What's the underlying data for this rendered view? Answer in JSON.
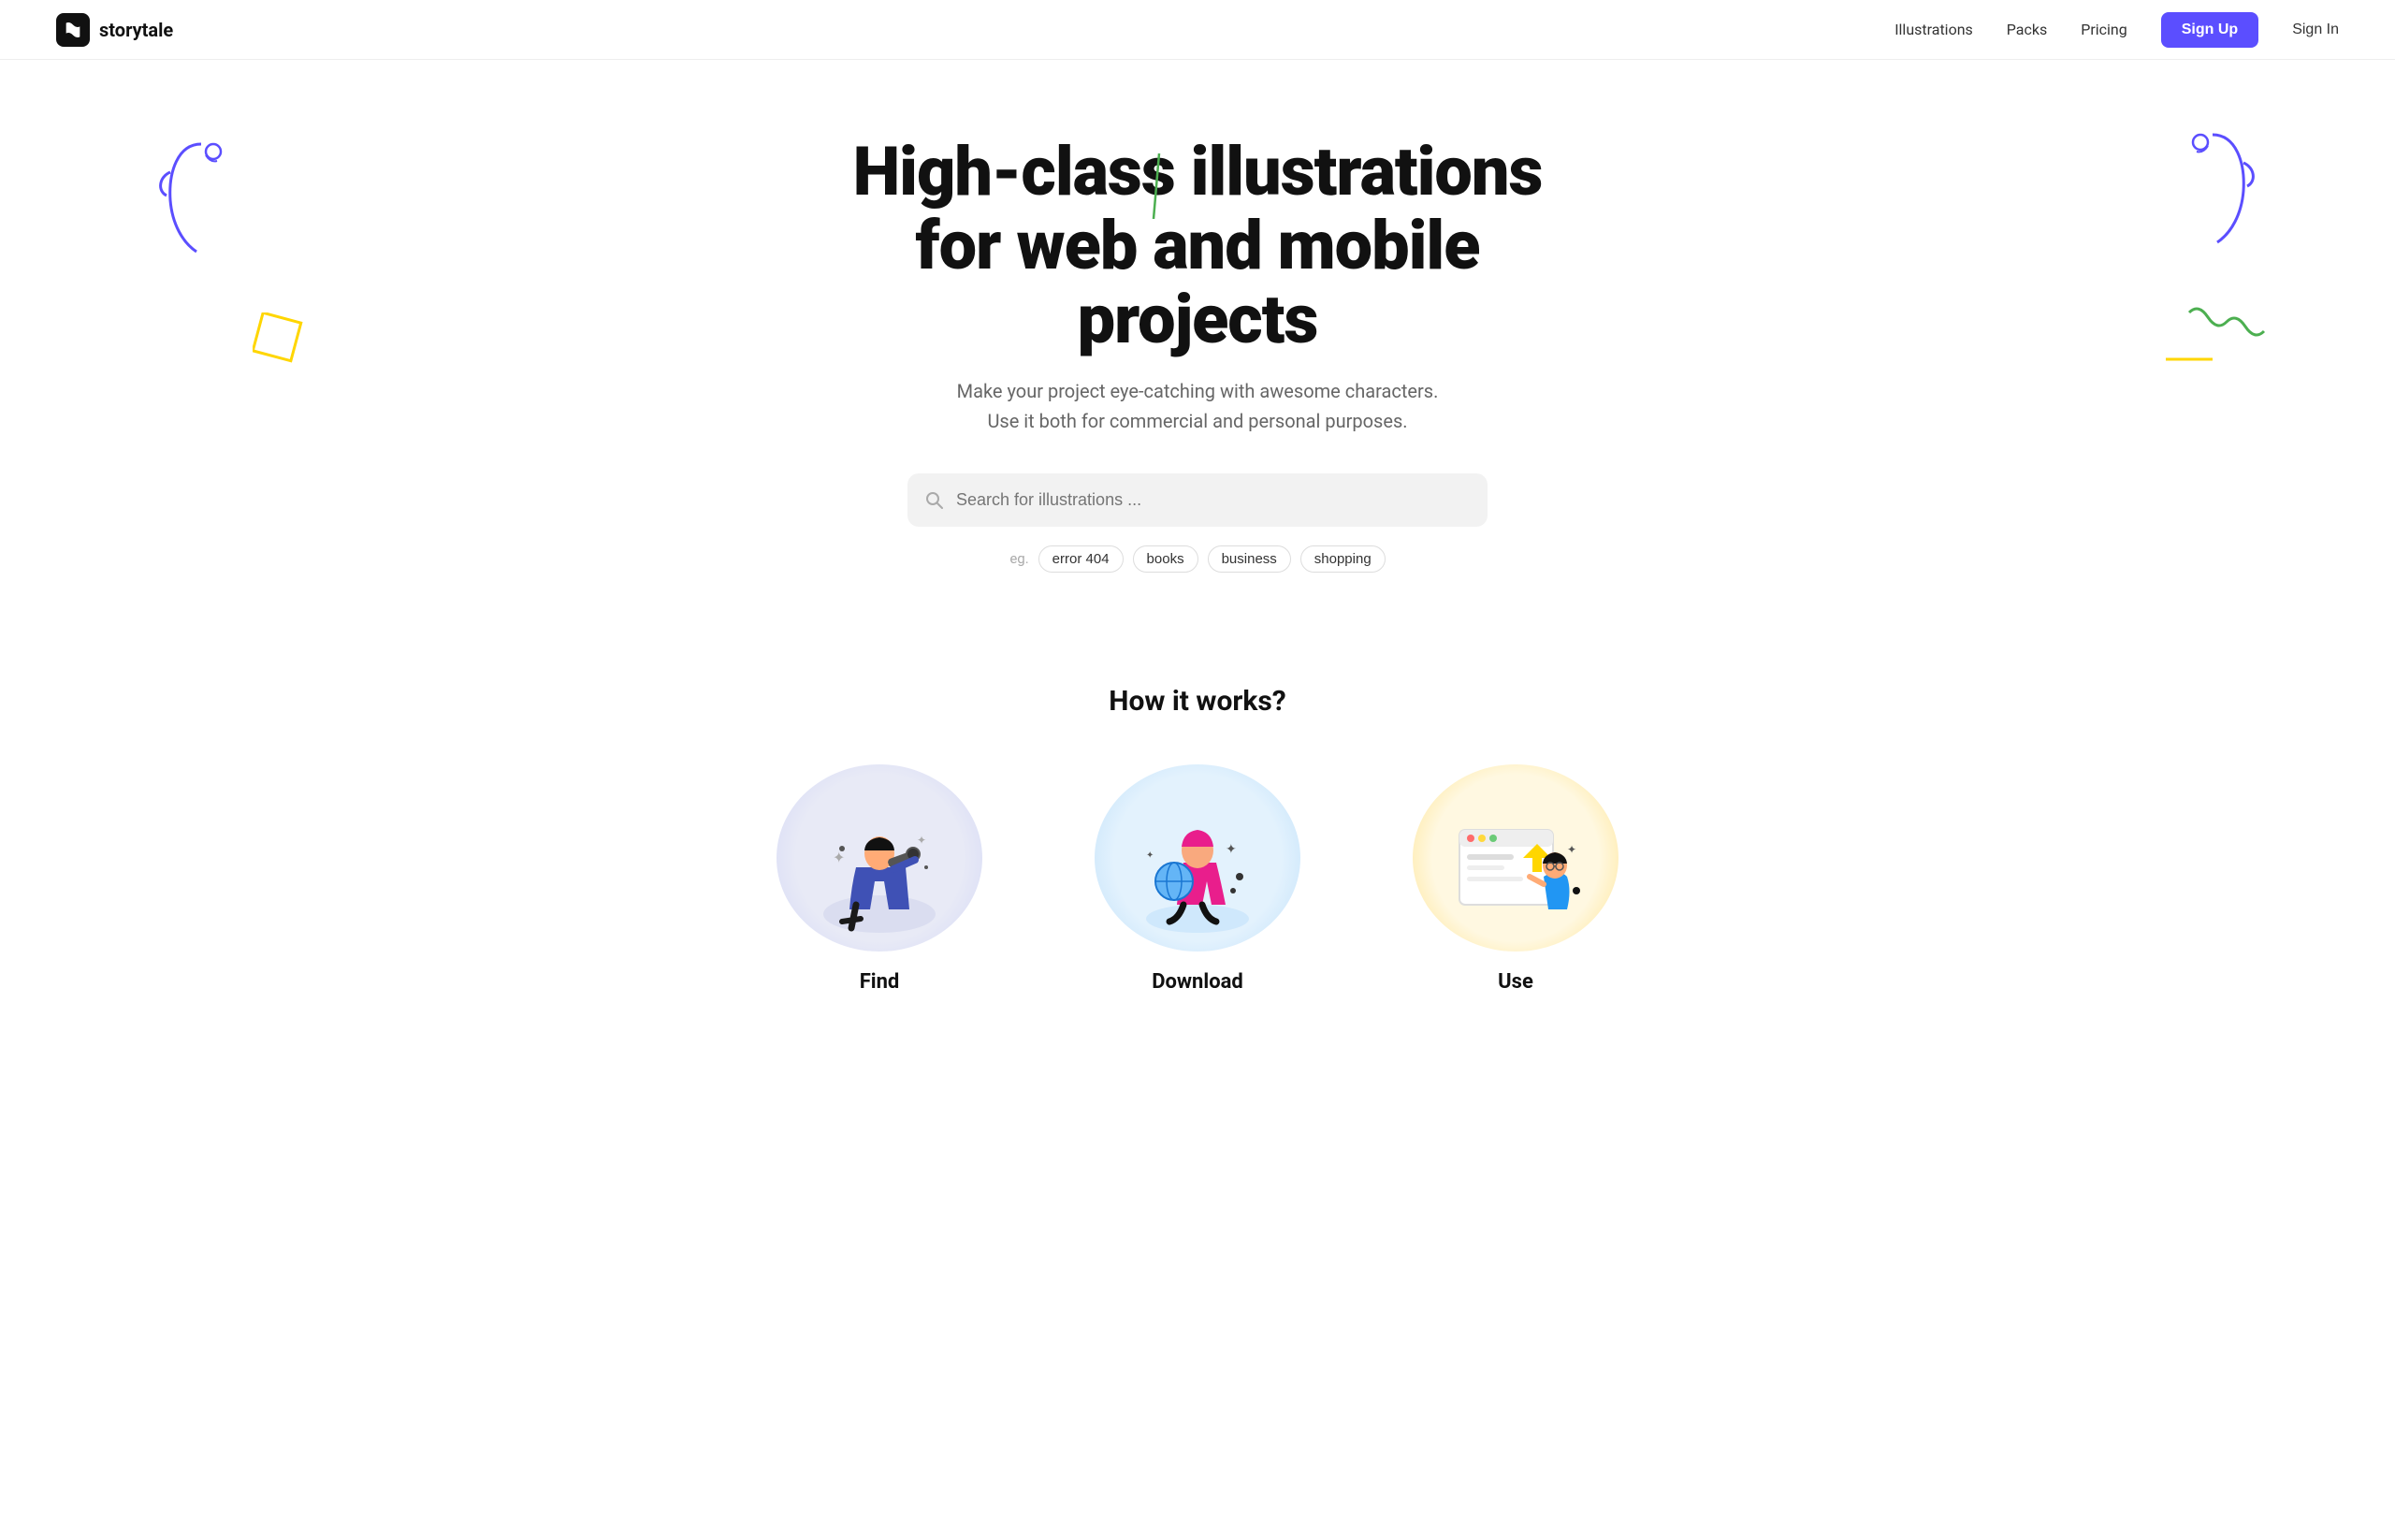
{
  "nav": {
    "logo_text": "storytale",
    "links": [
      {
        "label": "Illustrations",
        "id": "illustrations"
      },
      {
        "label": "Packs",
        "id": "packs"
      },
      {
        "label": "Pricing",
        "id": "pricing"
      }
    ],
    "signup_label": "Sign Up",
    "signin_label": "Sign In"
  },
  "hero": {
    "title": "High-class illustrations for web and mobile projects",
    "subtitle_line1": "Make your project eye-catching with awesome characters.",
    "subtitle_line2": "Use it both for commercial and personal purposes.",
    "search_placeholder": "Search for illustrations ..."
  },
  "tags": {
    "eg_label": "eg.",
    "items": [
      {
        "label": "error 404"
      },
      {
        "label": "books"
      },
      {
        "label": "business"
      },
      {
        "label": "shopping"
      }
    ]
  },
  "how": {
    "section_title": "How it works?",
    "cards": [
      {
        "label": "Find",
        "img_alt": "find-illustration"
      },
      {
        "label": "Download",
        "img_alt": "download-illustration"
      },
      {
        "label": "Use",
        "img_alt": "use-illustration"
      }
    ]
  }
}
